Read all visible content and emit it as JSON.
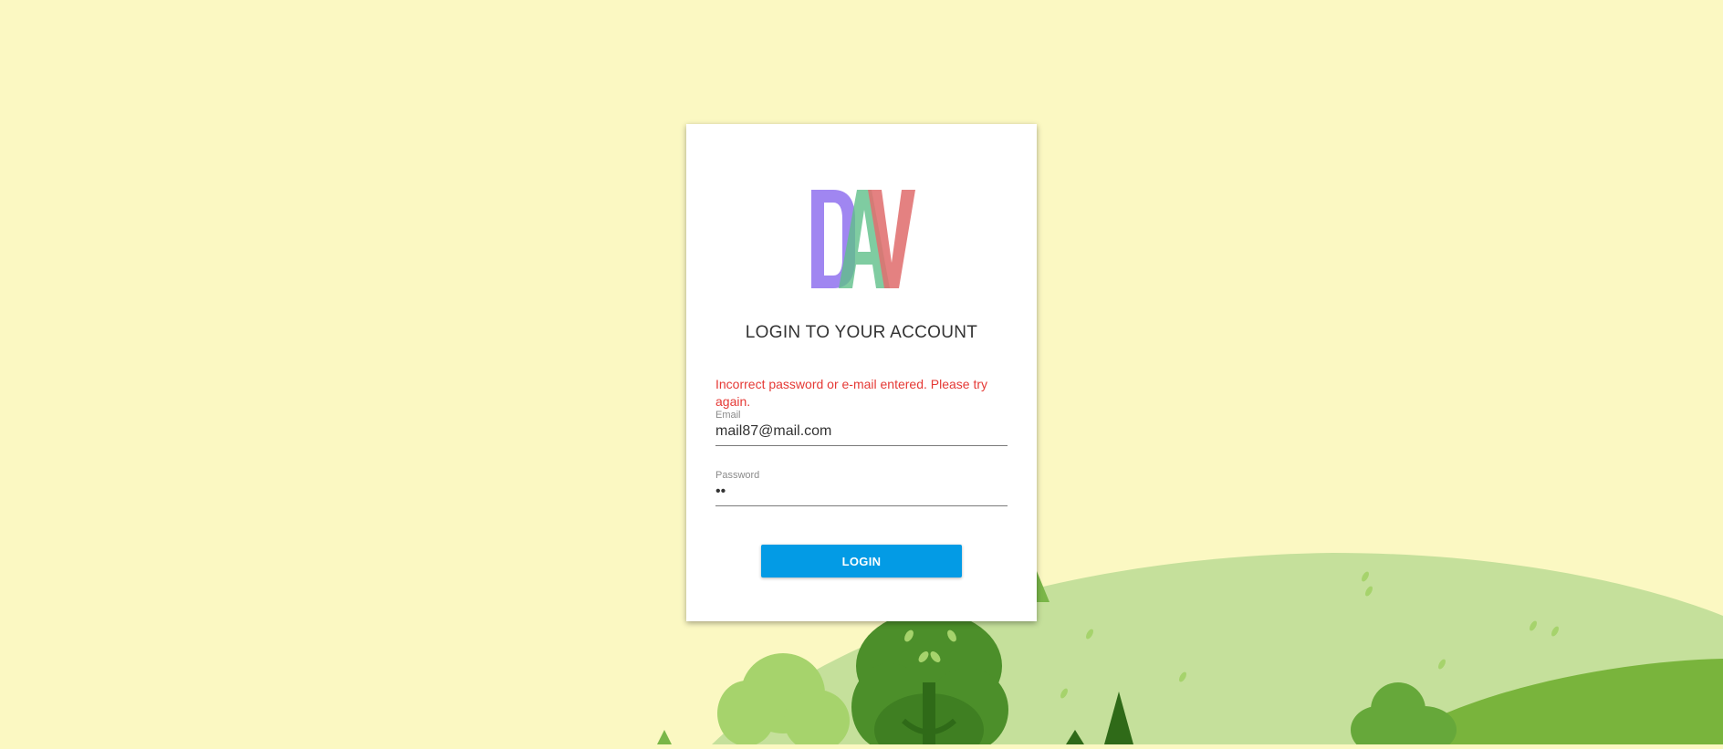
{
  "login": {
    "logo_text": "DAV",
    "heading": "LOGIN TO YOUR ACCOUNT",
    "error_message": "Incorrect password or e-mail entered. Please try again.",
    "email_label": "Email",
    "email_value": "mail87@mail.com",
    "password_label": "Password",
    "password_value": "••",
    "login_button": "LOGIN"
  },
  "colors": {
    "background": "#fbf8c2",
    "button": "#039be5",
    "error": "#e53935",
    "logo_d": "#9b7ff0",
    "logo_a": "#5fbf8a",
    "logo_v": "#e07070"
  }
}
